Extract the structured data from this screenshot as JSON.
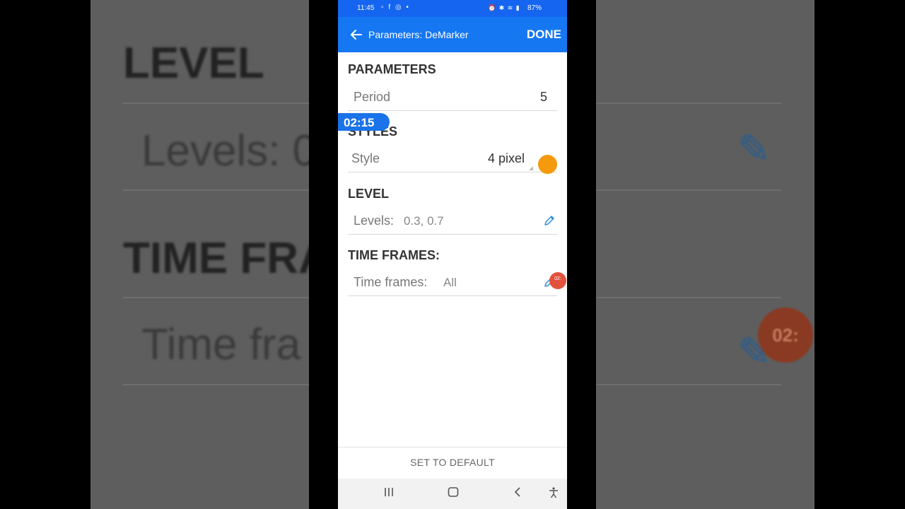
{
  "background": {
    "left_level": "LEVEL",
    "left_levels": "Levels: 0",
    "left_timeframes_title": "TIME FRA",
    "left_timeframes": "Time fra",
    "right_badge": "02:"
  },
  "status_bar": {
    "time": "11:45",
    "battery": "87%"
  },
  "app_bar": {
    "title": "Parameters: DeMarker",
    "done_label": "DONE"
  },
  "sections": {
    "parameters": "PARAMETERS",
    "styles": "STYLES",
    "level": "LEVEL",
    "time_frames": "TIME FRAMES:"
  },
  "period": {
    "label": "Period",
    "value": "5"
  },
  "style": {
    "label": "Style",
    "value": "4 pixel"
  },
  "levels": {
    "label": "Levels:",
    "value": "0.3, 0.7"
  },
  "time_frames": {
    "label": "Time frames:",
    "value": "All"
  },
  "overlay": {
    "timer": "02:15",
    "badge": "02:"
  },
  "footer": {
    "default_label": "SET TO DEFAULT"
  },
  "colors": {
    "app_bar": "#1677f2",
    "status_bar": "#1565f0",
    "accent_orange": "#f59a0c",
    "badge_red": "#e2523c"
  }
}
